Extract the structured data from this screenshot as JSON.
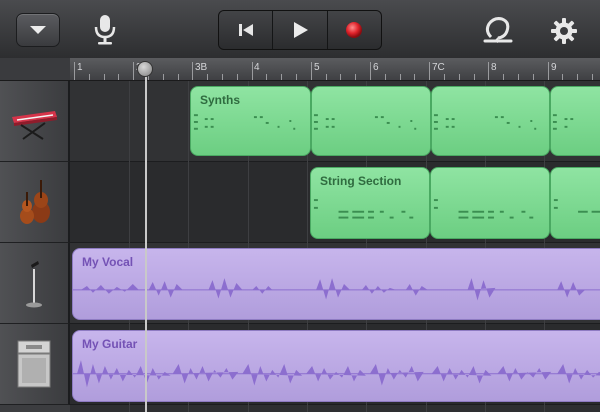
{
  "toolbar": {
    "menu_icon": "chevron-down-icon",
    "mic_icon": "microphone-icon",
    "transport": {
      "rewind_icon": "rewind-to-start-icon",
      "play_icon": "play-icon",
      "record_icon": "record-icon"
    },
    "loop_icon": "loop-icon",
    "settings_icon": "gear-icon"
  },
  "ruler": {
    "bar_labels": [
      "1",
      "2",
      "3B",
      "4",
      "5",
      "6",
      "7C",
      "8",
      "9"
    ]
  },
  "tracks": [
    {
      "instrument_icon": "keyboard-synth-icon",
      "region_name": "Synths"
    },
    {
      "instrument_icon": "violin-cello-icon",
      "region_name": "String Section"
    },
    {
      "instrument_icon": "microphone-stand-icon",
      "region_name": "My Vocal"
    },
    {
      "instrument_icon": "guitar-amp-icon",
      "region_name": "My Guitar"
    }
  ],
  "colors": {
    "midi_region": "#7ed692",
    "audio_region": "#bba8e5",
    "record": "#e0232b",
    "toolbar": "#3a3b3e"
  }
}
